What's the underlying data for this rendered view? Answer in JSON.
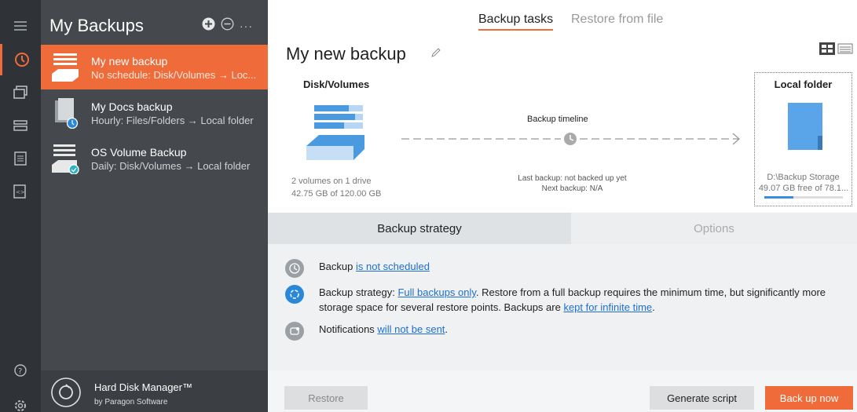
{
  "sidebar": {
    "title": "My Backups",
    "items": [
      {
        "name": "My new backup",
        "desc": "No schedule: Disk/Volumes → Loc..."
      },
      {
        "name": "My Docs backup",
        "desc": "Hourly: Files/Folders → Local folder"
      },
      {
        "name": "OS Volume Backup",
        "desc": "Daily: Disk/Volumes → Local folder"
      }
    ],
    "product_name": "Hard Disk Manager™",
    "product_by": "by Paragon Software",
    "more_label": "···"
  },
  "tabs": {
    "backup_tasks": "Backup tasks",
    "restore_from_file": "Restore from file"
  },
  "task": {
    "title": "My new backup"
  },
  "source": {
    "label": "Disk/Volumes",
    "info1": "2 volumes on 1 drive",
    "info2": "42.75 GB of 120.00 GB"
  },
  "timeline": {
    "label": "Backup timeline",
    "last": "Last backup: not backed up yet",
    "next": "Next backup: N/A"
  },
  "destination": {
    "label": "Local folder",
    "path": "D:\\Backup Storage",
    "free": "49.07 GB free of 78.1...",
    "used_fraction": 0.37
  },
  "strategy_tabs": {
    "strategy": "Backup strategy",
    "options": "Options"
  },
  "strategy": {
    "schedule_prefix": "Backup ",
    "schedule_link": "is not scheduled",
    "strategy_prefix": "Backup strategy: ",
    "strategy_link": "Full backups only",
    "strategy_text": ". Restore from a full backup requires the minimum time, but significantly more storage space for several restore points. Backups are ",
    "retention_link": "kept for infinite time",
    "retention_suffix": ".",
    "notif_prefix": "Notifications ",
    "notif_link": "will not be sent",
    "notif_suffix": "."
  },
  "buttons": {
    "restore": "Restore",
    "generate_script": "Generate script",
    "back_up_now": "Back up now"
  },
  "colors": {
    "accent": "#ef6b3a",
    "link": "#1d6fd0",
    "rail": "#2f3337",
    "sidebar": "#45494d"
  },
  "icons": [
    "menu-icon",
    "history-icon",
    "clone-icon",
    "drive-icon",
    "log-icon",
    "script-icon",
    "help-icon",
    "settings-icon",
    "add-icon",
    "remove-icon",
    "edit-icon",
    "clock-icon",
    "strategy-icon",
    "notification-icon"
  ]
}
